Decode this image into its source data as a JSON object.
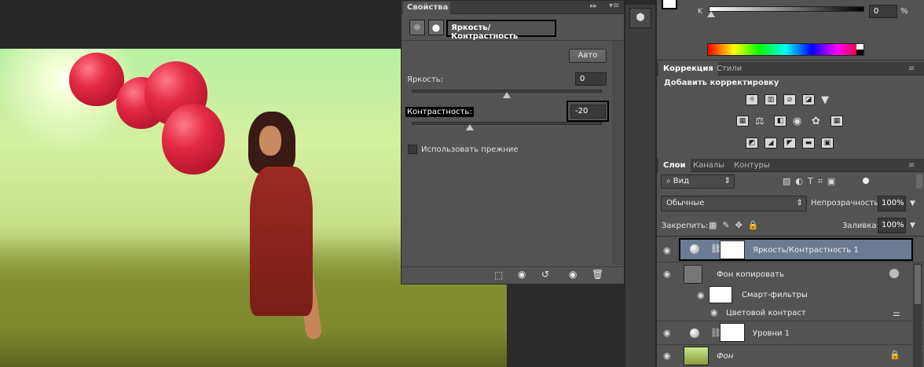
{
  "properties": {
    "tab_label": "Свойства",
    "title": "Яркость/Контрастность",
    "auto_label": "Авто",
    "brightness_label": "Яркость:",
    "brightness_value": "0",
    "contrast_label": "Контрастность:",
    "contrast_value": "-20",
    "use_legacy_label": "Использовать прежние"
  },
  "color_panel": {
    "k_label": "K",
    "k_value": "0",
    "k_unit": "%"
  },
  "adjustments": {
    "tabs": [
      "Коррекция",
      "Стили"
    ],
    "heading": "Добавить корректировку"
  },
  "layers_panel": {
    "tabs": [
      "Слои",
      "Каналы",
      "Контуры"
    ],
    "filter_label": "Вид",
    "blend_mode": "Обычные",
    "opacity_label": "Непрозрачность:",
    "opacity_value": "100%",
    "lock_label": "Закрепить:",
    "fill_label": "Заливка:",
    "fill_value": "100%",
    "layers": [
      {
        "name": "Яркость/Контрастность 1"
      },
      {
        "name": "Фон копировать"
      },
      {
        "name": "Смарт-фильтры"
      },
      {
        "name": "Цветовой контраст"
      },
      {
        "name": "Уровни 1"
      },
      {
        "name": "Фон"
      }
    ]
  },
  "colors": {
    "panel_bg": "#535353",
    "selected_layer": "#6d7a93",
    "dark_bg": "#282828"
  }
}
